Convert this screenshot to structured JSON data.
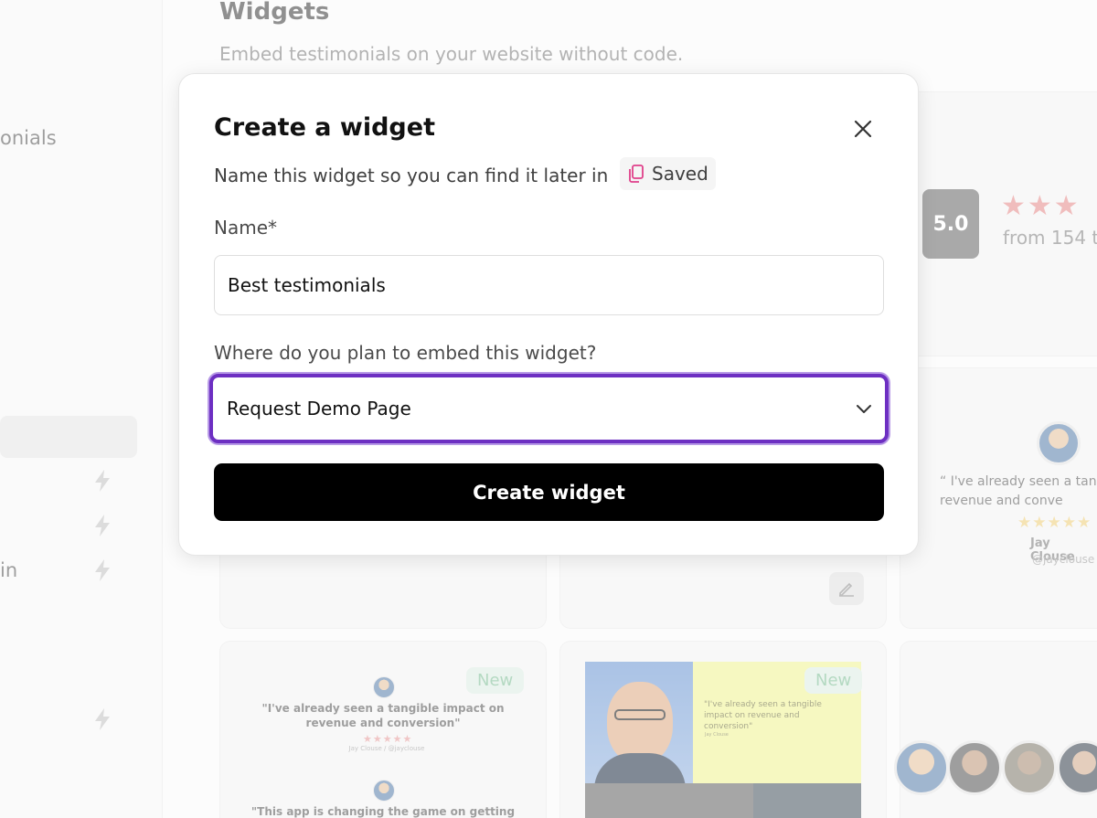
{
  "sidebar": {
    "partial_labels": [
      "onials",
      "in"
    ]
  },
  "header": {
    "title": "Widgets",
    "subtitle": "Embed testimonials on your website without code."
  },
  "widgets": {
    "rating": {
      "score": "5.0",
      "stars": "★★★",
      "from_text": "from 154 t"
    },
    "card_wall": {
      "quote": "“ I've already seen a tangi revenue and conve",
      "stars": "★★★★★",
      "name": "Jay Clouse",
      "handle": "@jayclouse"
    },
    "card_list": {
      "badge": "New",
      "quote": "\"I've already seen a tangible impact on revenue and conversion\"",
      "stars": "★★★★★",
      "byline": "Jay Clouse / @jayclouse",
      "quote2": "\"This app is changing the game on getting social"
    },
    "card_photo": {
      "badge": "New",
      "quote": "\"I've already seen a tangible impact on revenue and conversion\"",
      "byline": "Jay Clouse"
    }
  },
  "modal": {
    "title": "Create a widget",
    "description": "Name this widget so you can find it later in",
    "saved_label": "Saved",
    "name_label": "Name*",
    "name_value": "Best testimonials",
    "embed_label": "Where do you plan to embed this widget?",
    "embed_value": "Request Demo Page",
    "submit_label": "Create widget"
  },
  "colors": {
    "accent": "#6d2fc2",
    "primary_button": "#000000",
    "saved_icon": "#e0408a"
  },
  "icons": [
    "close-icon",
    "copy-icon",
    "chevron-down-icon",
    "bolt-icon",
    "pen-icon"
  ]
}
